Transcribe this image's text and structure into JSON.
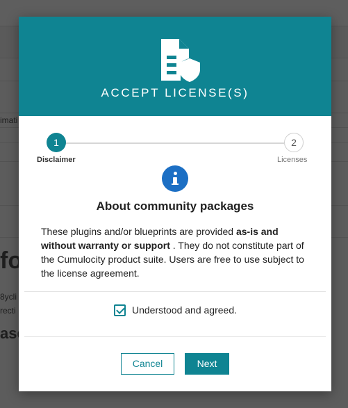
{
  "background": {
    "fragments": [
      "imati",
      "fo",
      "8ycli",
      "recti",
      "ase"
    ]
  },
  "modal": {
    "title": "ACCEPT LICENSE(S)",
    "header_icon": "document-shield-icon",
    "stepper": {
      "steps": [
        {
          "number": "1",
          "label": "Disclaimer",
          "active": true
        },
        {
          "number": "2",
          "label": "Licenses",
          "active": false
        }
      ]
    },
    "info_icon": "info-icon",
    "heading": "About community packages",
    "description": {
      "part1": "These plugins and/or blueprints are provided ",
      "bold": "as-is and without warranty or support",
      "part2": " . They do not constitute part of the Cumulocity product suite. Users are free to use subject to the license agreement."
    },
    "agreement": {
      "label": "Understood and agreed.",
      "checked": true
    },
    "buttons": {
      "cancel": "Cancel",
      "next": "Next"
    }
  },
  "colors": {
    "accent": "#0f8492",
    "info": "#1c6fc4"
  }
}
